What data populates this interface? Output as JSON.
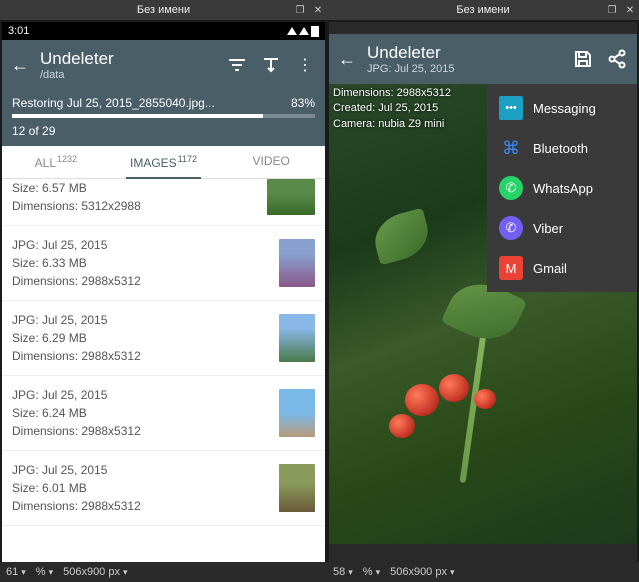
{
  "left": {
    "window_title": "Без имени",
    "status": {
      "time": "3:01"
    },
    "header": {
      "title": "Undeleter",
      "subtitle": "/data"
    },
    "progress": {
      "text": "Restoring Jul 25, 2015_2855040.jpg...",
      "percent": "83%",
      "count": "12 of 29"
    },
    "tabs": {
      "all": {
        "label": "ALL",
        "count": "1232"
      },
      "images": {
        "label": "IMAGES",
        "count": "1172"
      },
      "video": {
        "label": "VIDEO"
      }
    },
    "items": [
      {
        "l1": "Size: 6.57 MB",
        "l2": "Dimensions: 5312x2988"
      },
      {
        "l1": "JPG: Jul 25, 2015",
        "l2": "Size: 6.33 MB",
        "l3": "Dimensions: 2988x5312"
      },
      {
        "l1": "JPG: Jul 25, 2015",
        "l2": "Size: 6.29 MB",
        "l3": "Dimensions: 2988x5312"
      },
      {
        "l1": "JPG: Jul 25, 2015",
        "l2": "Size: 6.24 MB",
        "l3": "Dimensions: 2988x5312"
      },
      {
        "l1": "JPG: Jul 25, 2015",
        "l2": "Size: 6.01 MB",
        "l3": "Dimensions: 2988x5312"
      }
    ],
    "bottom": {
      "zoom": "61",
      "pct": "%",
      "dims": "506x900 px"
    }
  },
  "right": {
    "window_title": "Без имени",
    "header": {
      "title": "Undeleter",
      "subtitle": "JPG: Jul 25, 2015"
    },
    "meta": {
      "l1": "Dimensions: 2988x5312",
      "l2": "Created: Jul 25, 2015",
      "l3": "Camera: nubia Z9 mini"
    },
    "share": {
      "items": [
        {
          "label": "Messaging"
        },
        {
          "label": "Bluetooth"
        },
        {
          "label": "WhatsApp"
        },
        {
          "label": "Viber"
        },
        {
          "label": "Gmail"
        }
      ]
    },
    "bottom": {
      "zoom": "58",
      "pct": "%",
      "dims": "506x900 px"
    }
  }
}
